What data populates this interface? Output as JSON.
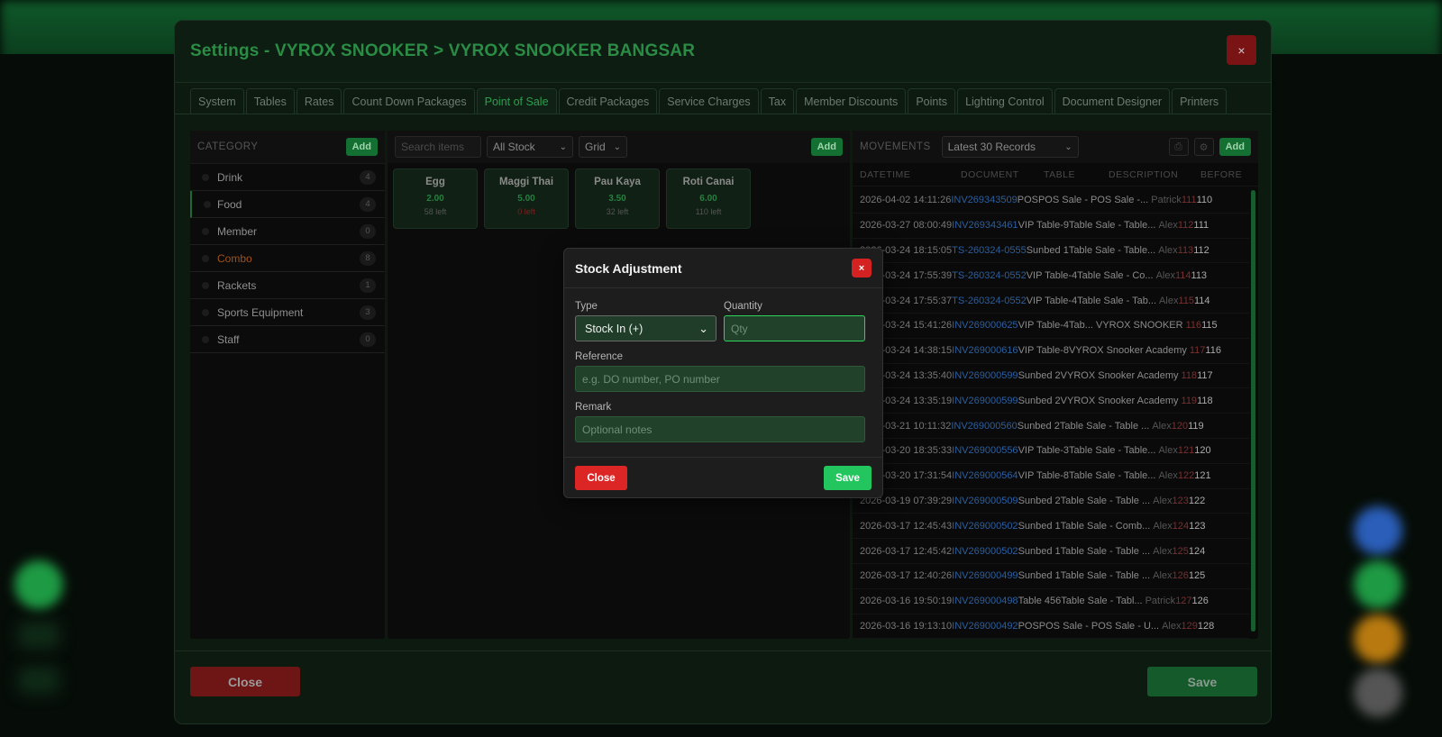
{
  "window": {
    "title": "Settings - VYROX SNOOKER > VYROX SNOOKER BANGSAR",
    "close_x": "×"
  },
  "tabs": [
    "System",
    "Tables",
    "Rates",
    "Count Down Packages",
    "Point of Sale",
    "Credit Packages",
    "Service Charges",
    "Tax",
    "Member Discounts",
    "Points",
    "Lighting Control",
    "Document Designer",
    "Printers"
  ],
  "active_tab": "Point of Sale",
  "category": {
    "label": "CATEGORY",
    "add_label": "Add",
    "items": [
      {
        "name": "Drink",
        "count": "4"
      },
      {
        "name": "Food",
        "count": "4",
        "active": true
      },
      {
        "name": "Member",
        "count": "0"
      },
      {
        "name": "Combo",
        "count": "8",
        "highlight": "#a0521a"
      },
      {
        "name": "Rackets",
        "count": "1"
      },
      {
        "name": "Sports Equipment",
        "count": "3"
      },
      {
        "name": "Staff",
        "count": "0"
      }
    ]
  },
  "items_panel": {
    "search_placeholder": "Search items",
    "stock_filter": "All Stock",
    "view_mode": "Grid",
    "add_label": "Add",
    "items": [
      {
        "name": "Egg",
        "price": "2.00",
        "stock": "58 left"
      },
      {
        "name": "Maggi Thai",
        "price": "5.00",
        "stock": "0 left",
        "out": true
      },
      {
        "name": "Pau Kaya",
        "price": "3.50",
        "stock": "32 left"
      },
      {
        "name": "Roti Canai",
        "price": "6.00",
        "stock": "110 left"
      }
    ]
  },
  "movements": {
    "label": "MOVEMENTS",
    "filter": "Latest 30 Records",
    "add_label": "Add",
    "columns": [
      "DATETIME",
      "DOCUMENT",
      "TABLE",
      "DESCRIPTION",
      "BEFORE"
    ],
    "rows": [
      {
        "dt": "2026-04-02 14:11:26",
        "doc": "INV269343509",
        "tbl": "POSPOS Sale - POS Sale -...",
        "usr": "Patrick",
        "bf": "111",
        "af": "110"
      },
      {
        "dt": "2026-03-27 08:00:49",
        "doc": "INV269343461",
        "tbl": "VIP Table-9Table Sale - Table...",
        "usr": "Alex",
        "bf": "112",
        "af": "111"
      },
      {
        "dt": "2026-03-24 18:15:05",
        "doc": "TS-260324-0555",
        "tbl": "Sunbed 1Table Sale - Table...",
        "usr": "Alex",
        "bf": "113",
        "af": "112"
      },
      {
        "dt": "2026-03-24 17:55:39",
        "doc": "TS-260324-0552",
        "tbl": "VIP Table-4Table Sale - Co...",
        "usr": "Alex",
        "bf": "114",
        "af": "113"
      },
      {
        "dt": "2026-03-24 17:55:37",
        "doc": "TS-260324-0552",
        "tbl": "VIP Table-4Table Sale - Tab...",
        "usr": "Alex",
        "bf": "115",
        "af": "114"
      },
      {
        "dt": "2026-03-24 15:41:26",
        "doc": "INV269000625",
        "tbl": "VIP Table-4Tab... VYROX SNOOKER",
        "usr": "",
        "bf": "116",
        "af": "115"
      },
      {
        "dt": "2026-03-24 14:38:15",
        "doc": "INV269000616",
        "tbl": "VIP Table-8VYROX Snooker Academy",
        "usr": "",
        "bf": "117",
        "af": "116"
      },
      {
        "dt": "2026-03-24 13:35:40",
        "doc": "INV269000599",
        "tbl": "Sunbed 2VYROX Snooker Academy",
        "usr": "",
        "bf": "118",
        "af": "117"
      },
      {
        "dt": "2026-03-24 13:35:19",
        "doc": "INV269000599",
        "tbl": "Sunbed 2VYROX Snooker Academy",
        "usr": "",
        "bf": "119",
        "af": "118"
      },
      {
        "dt": "2026-03-21 10:11:32",
        "doc": "INV269000560",
        "tbl": "Sunbed 2Table Sale - Table ...",
        "usr": "Alex",
        "bf": "120",
        "af": "119"
      },
      {
        "dt": "2026-03-20 18:35:33",
        "doc": "INV269000556",
        "tbl": "VIP Table-3Table Sale - Table...",
        "usr": "Alex",
        "bf": "121",
        "af": "120"
      },
      {
        "dt": "2026-03-20 17:31:54",
        "doc": "INV269000564",
        "tbl": "VIP Table-8Table Sale - Table...",
        "usr": "Alex",
        "bf": "122",
        "af": "121"
      },
      {
        "dt": "2026-03-19 07:39:29",
        "doc": "INV269000509",
        "tbl": "Sunbed 2Table Sale - Table ...",
        "usr": "Alex",
        "bf": "123",
        "af": "122"
      },
      {
        "dt": "2026-03-17 12:45:43",
        "doc": "INV269000502",
        "tbl": "Sunbed 1Table Sale - Comb...",
        "usr": "Alex",
        "bf": "124",
        "af": "123"
      },
      {
        "dt": "2026-03-17 12:45:42",
        "doc": "INV269000502",
        "tbl": "Sunbed 1Table Sale - Table ...",
        "usr": "Alex",
        "bf": "125",
        "af": "124"
      },
      {
        "dt": "2026-03-17 12:40:26",
        "doc": "INV269000499",
        "tbl": "Sunbed 1Table Sale - Table ...",
        "usr": "Alex",
        "bf": "126",
        "af": "125"
      },
      {
        "dt": "2026-03-16 19:50:19",
        "doc": "INV269000498",
        "tbl": "Table 456Table Sale - Tabl...",
        "usr": "Patrick",
        "bf": "127",
        "af": "126"
      },
      {
        "dt": "2026-03-16 19:13:10",
        "doc": "INV269000492",
        "tbl": "POSPOS Sale - POS Sale - U...",
        "usr": "Alex",
        "bf": "129",
        "af": "128"
      }
    ]
  },
  "footer": {
    "close_label": "Close",
    "save_label": "Save"
  },
  "modal": {
    "title": "Stock Adjustment",
    "close_x": "×",
    "type_label": "Type",
    "type_value": "Stock In (+)",
    "quantity_label": "Quantity",
    "quantity_placeholder": "Qty",
    "reference_label": "Reference",
    "reference_placeholder": "e.g. DO number, PO number",
    "remark_label": "Remark",
    "remark_placeholder": "Optional notes",
    "close_label": "Close",
    "save_label": "Save"
  },
  "colors": {
    "accent_green": "#22c55e",
    "danger_red": "#dc2626",
    "title_green": "#2a8c45",
    "doc_link_blue": "#2a5fa0"
  }
}
